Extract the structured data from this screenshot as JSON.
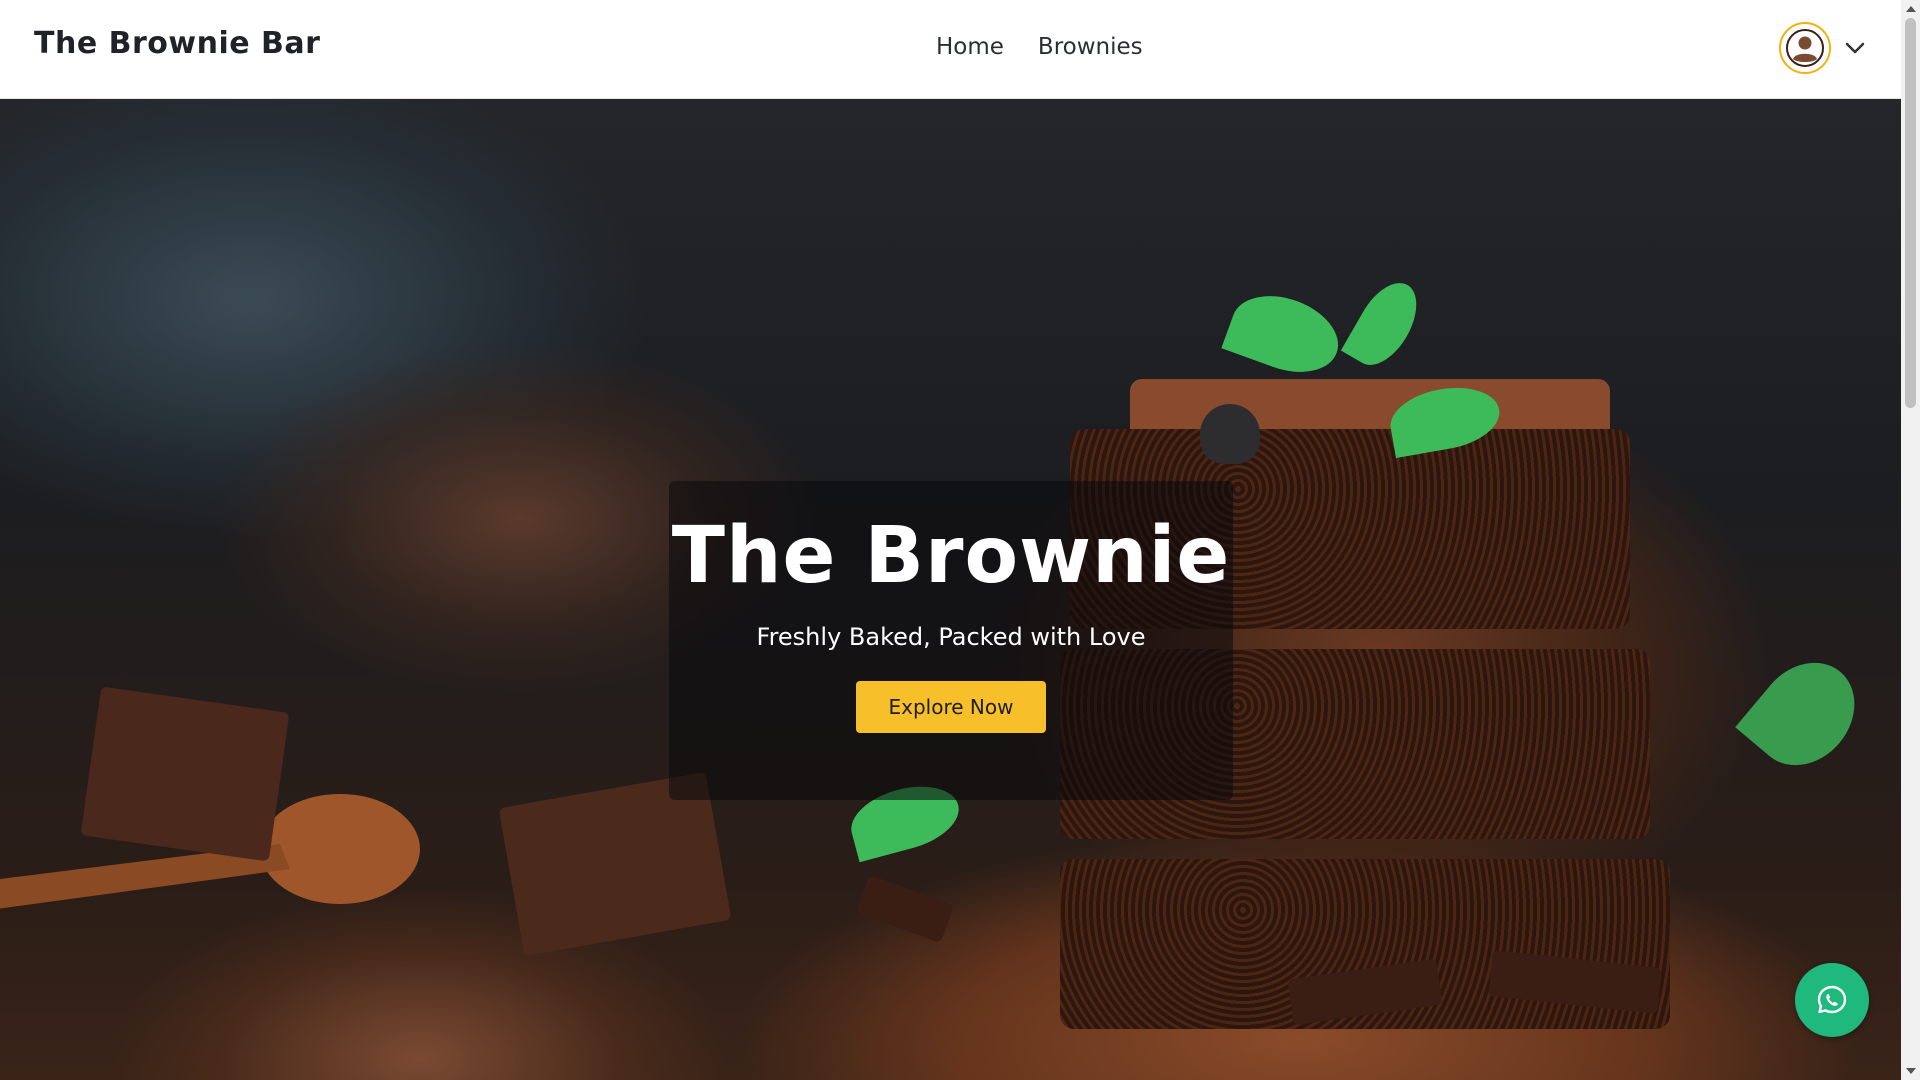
{
  "header": {
    "brand": "The Brownie Bar",
    "nav": [
      {
        "label": "Home"
      },
      {
        "label": "Brownies"
      }
    ],
    "user_menu": {
      "avatar_icon": "user-circle-icon",
      "chevron_icon": "chevron-down-icon"
    }
  },
  "hero": {
    "title": "The Brownie",
    "subtitle": "Freshly Baked, Packed with Love",
    "cta_label": "Explore Now"
  },
  "floating": {
    "whatsapp_icon": "whatsapp-icon"
  },
  "colors": {
    "accent": "#f7bf2a",
    "avatar_ring": "#f2b10f",
    "whatsapp": "#1fb97e",
    "header_bg": "#ffffff",
    "brand_text": "#1f2226"
  }
}
